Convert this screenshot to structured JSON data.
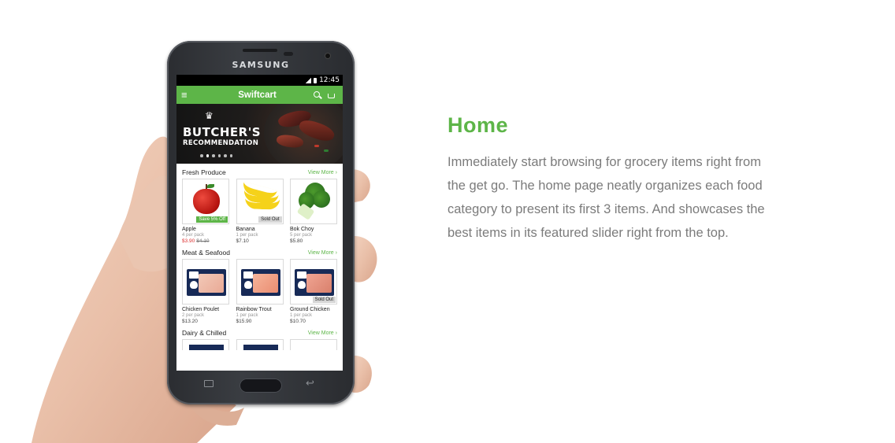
{
  "device": {
    "brand": "SAMSUNG"
  },
  "statusbar": {
    "time": "12:45"
  },
  "app": {
    "title": "Swiftcart",
    "banner": {
      "line1": "BUTCHER'S",
      "line2": "RECOMMENDATION",
      "slides": 6,
      "active_slide": 2
    },
    "view_more": "View More",
    "sections": [
      {
        "title": "Fresh Produce",
        "products": [
          {
            "name": "Apple",
            "pack": "4 per pack",
            "price": "$3.90",
            "old_price": "$4.10",
            "badge": "Save 5% Off"
          },
          {
            "name": "Banana",
            "pack": "1 per pack",
            "price": "$7.10",
            "badge": "Sold Out"
          },
          {
            "name": "Bok Choy",
            "pack": "5 per pack",
            "price": "$5.80"
          }
        ]
      },
      {
        "title": "Meat & Seafood",
        "products": [
          {
            "name": "Chicken Poulet",
            "pack": "2 per pack",
            "price": "$13.20"
          },
          {
            "name": "Rainbow Trout",
            "pack": "1 per pack",
            "price": "$15.90"
          },
          {
            "name": "Ground Chicken",
            "pack": "1 per pack",
            "price": "$10.70",
            "badge": "Sold Out"
          }
        ]
      },
      {
        "title": "Dairy & Chilled"
      }
    ]
  },
  "copy": {
    "heading": "Home",
    "body": "Immediately start browsing for grocery items right from the get go. The home page neatly organizes each food category to present its first 3 items. And showcases the best items in its featured slider right from the top."
  },
  "colors": {
    "accent": "#5db548",
    "sale": "#dd3333",
    "body_text": "#7b7b7b"
  },
  "icons": [
    "menu-icon",
    "search-icon",
    "cart-icon",
    "chef-hat-icon",
    "chevron-right-icon",
    "recent-apps-icon",
    "back-icon"
  ]
}
